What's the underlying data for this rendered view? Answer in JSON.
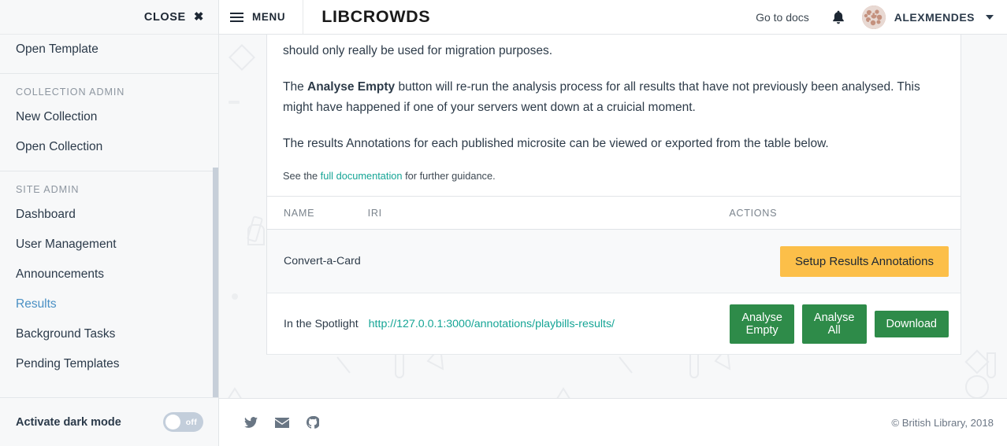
{
  "sidebar": {
    "close_label": "CLOSE",
    "close_icon": "close-x-icon",
    "top_items": [
      {
        "label": "Open Template",
        "active": false
      }
    ],
    "groups": [
      {
        "title": "COLLECTION ADMIN",
        "items": [
          {
            "label": "New Collection",
            "active": false
          },
          {
            "label": "Open Collection",
            "active": false
          }
        ]
      },
      {
        "title": "SITE ADMIN",
        "items": [
          {
            "label": "Dashboard",
            "active": false
          },
          {
            "label": "User Management",
            "active": false
          },
          {
            "label": "Announcements",
            "active": false
          },
          {
            "label": "Results",
            "active": true
          },
          {
            "label": "Background Tasks",
            "active": false
          },
          {
            "label": "Pending Templates",
            "active": false
          }
        ]
      }
    ],
    "dark_mode": {
      "label": "Activate dark mode",
      "state_label": "off",
      "enabled": false
    }
  },
  "navbar": {
    "menu_label": "MENU",
    "menu_icon": "hamburger-icon",
    "brand": "LIBCROWDS",
    "docs_link": "Go to docs",
    "bell_icon": "notification-bell-icon",
    "avatar_icon": "user-avatar",
    "user_name": "ALEXMENDES",
    "caret_icon": "chevron-down-icon"
  },
  "content": {
    "paragraphs": [
      {
        "parts": [
          {
            "text": "should only really be used for migration purposes.",
            "bold": false
          }
        ]
      },
      {
        "parts": [
          {
            "text": "The ",
            "bold": false
          },
          {
            "text": "Analyse Empty",
            "bold": true
          },
          {
            "text": " button will re-run the analysis process for all results that have not previously been analysed. This might have happened if one of your servers went down at a cruicial moment.",
            "bold": false
          }
        ]
      },
      {
        "parts": [
          {
            "text": "The results Annotations for each published microsite can be viewed or exported from the table below.",
            "bold": false
          }
        ]
      }
    ],
    "note_prefix": "See the ",
    "note_link": "full documentation",
    "note_suffix": " for further guidance."
  },
  "table": {
    "headers": {
      "name": "NAME",
      "iri": "IRI",
      "actions": "ACTIONS"
    },
    "rows": [
      {
        "name": "Convert-a-Card",
        "iri": "",
        "actions": [
          {
            "label": "Setup Results Annotations",
            "style": "warn"
          }
        ]
      },
      {
        "name": "In the Spotlight",
        "iri": "http://127.0.0.1:3000/annotations/playbills-results/",
        "actions": [
          {
            "label": "Analyse Empty",
            "style": "green"
          },
          {
            "label": "Analyse All",
            "style": "green"
          },
          {
            "label": "Download",
            "style": "green"
          }
        ]
      }
    ]
  },
  "footer": {
    "social": [
      {
        "icon": "twitter-icon"
      },
      {
        "icon": "email-icon"
      },
      {
        "icon": "github-icon"
      }
    ],
    "copyright": "© British Library, 2018"
  },
  "colors": {
    "accent_green": "#2e8b49",
    "accent_warn": "#fcbf49",
    "link_teal": "#16a596",
    "sidebar_active": "#4a90c4",
    "toggle_off": "#c3cedb"
  }
}
